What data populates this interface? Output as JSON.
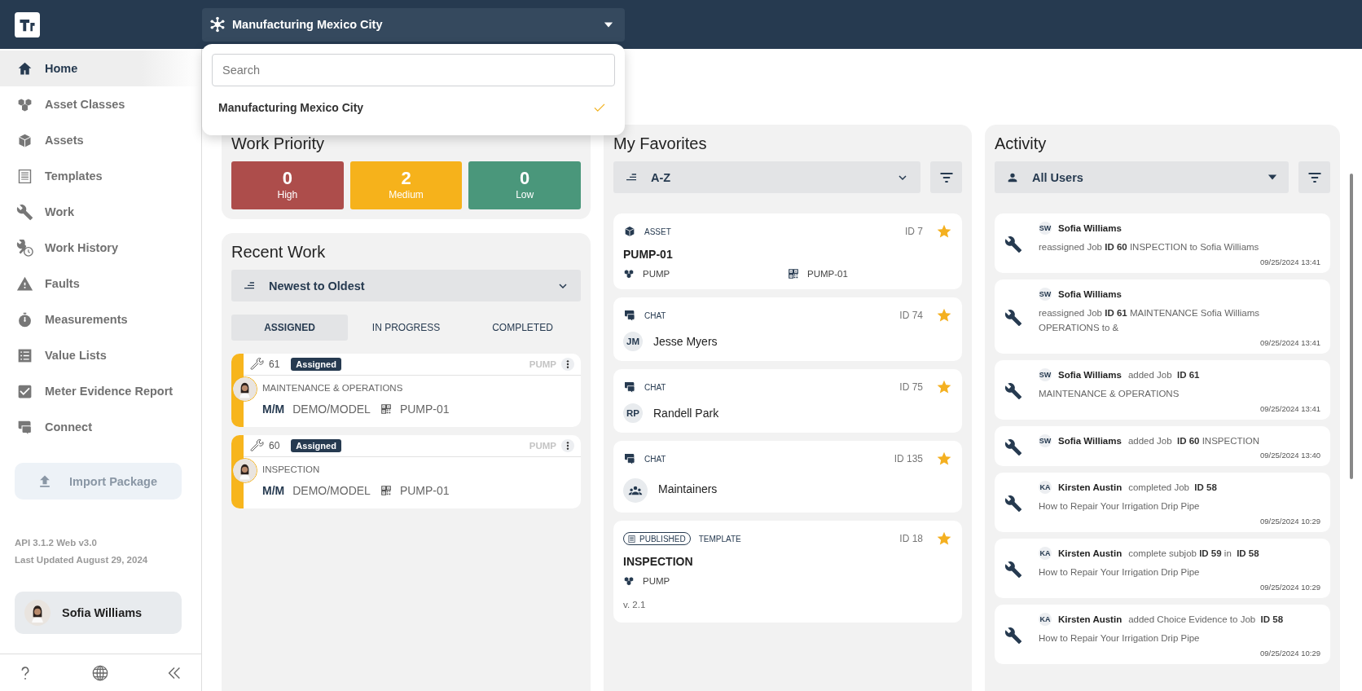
{
  "header": {
    "site": "Manufacturing Mexico City"
  },
  "site_menu": {
    "search": {
      "placeholder": "Search"
    },
    "options": [
      {
        "label": "Manufacturing Mexico City",
        "selected": true
      }
    ]
  },
  "sidebar": {
    "items": [
      {
        "label": "Home",
        "selected": true
      },
      {
        "label": "Asset Classes",
        "selected": false
      },
      {
        "label": "Assets",
        "selected": false
      },
      {
        "label": "Templates",
        "selected": false
      },
      {
        "label": "Work",
        "selected": false
      },
      {
        "label": "Work History",
        "selected": false
      },
      {
        "label": "Faults",
        "selected": false
      },
      {
        "label": "Measurements",
        "selected": false
      },
      {
        "label": "Value Lists",
        "selected": false
      },
      {
        "label": "Meter Evidence Report",
        "selected": false
      },
      {
        "label": "Connect",
        "selected": false
      }
    ],
    "import_button": "Import Package",
    "version": "API 3.1.2 Web v3.0",
    "updated": "Last Updated August 29, 2024",
    "user": "Sofia Williams"
  },
  "work_priority": {
    "title": "Work Priority",
    "tiles": [
      {
        "count": "0",
        "label": "High",
        "color": "#ad4d4b"
      },
      {
        "count": "2",
        "label": "Medium",
        "color": "#f6b21b"
      },
      {
        "count": "0",
        "label": "Low",
        "color": "#4a977b"
      }
    ]
  },
  "recent_work": {
    "title": "Recent Work",
    "sort": "Newest to Oldest",
    "tabs": [
      {
        "label": "ASSIGNED",
        "selected": true
      },
      {
        "label": "IN PROGRESS",
        "selected": false
      },
      {
        "label": "COMPLETED",
        "selected": false
      }
    ],
    "jobs": [
      {
        "id": "61",
        "status": "Assigned",
        "asset_class": "PUMP",
        "title": "MAINTENANCE & OPERATIONS",
        "make": "M/M",
        "model": "DEMO/MODEL",
        "asset": "PUMP-01",
        "color": "#f7b51d"
      },
      {
        "id": "60",
        "status": "Assigned",
        "asset_class": "PUMP",
        "title": "INSPECTION",
        "make": "M/M",
        "model": "DEMO/MODEL",
        "asset": "PUMP-01",
        "color": "#f7b51d"
      }
    ]
  },
  "favorites": {
    "title": "My Favorites",
    "sort": "A-Z",
    "items": [
      {
        "kind": "asset",
        "type": "ASSET",
        "id": "ID 7",
        "starred": true,
        "name": "PUMP-01",
        "asset_class": "PUMP",
        "asset": "PUMP-01"
      },
      {
        "kind": "chat",
        "type": "CHAT",
        "id": "ID 74",
        "starred": true,
        "initials": "JM",
        "name": "Jesse Myers"
      },
      {
        "kind": "chat",
        "type": "CHAT",
        "id": "ID 75",
        "starred": true,
        "initials": "RP",
        "name": "Randell Park"
      },
      {
        "kind": "chat",
        "type": "CHAT",
        "id": "ID 135",
        "starred": true,
        "name": "Maintainers"
      },
      {
        "kind": "template",
        "badge": "PUBLISHED",
        "type": "TEMPLATE",
        "id": "ID 18",
        "starred": true,
        "name": "INSPECTION",
        "asset_class": "PUMP",
        "version": "v. 2.1"
      }
    ]
  },
  "activity": {
    "title": "Activity",
    "filter": "All Users",
    "items": [
      {
        "initials": "SW",
        "user": "Sofia Williams",
        "detail": "reassigned Job **ID 60** INSPECTION to Sofia Williams",
        "time": "09/25/2024 13:41"
      },
      {
        "initials": "SW",
        "user": "Sofia Williams",
        "detail": "reassigned Job **ID 61** MAINTENANCE Sofia Williams OPERATIONS to &",
        "time": "09/25/2024 13:41"
      },
      {
        "initials": "SW",
        "user": "Sofia Williams",
        "action": "added Job  **ID 61**",
        "detail": "MAINTENANCE & OPERATIONS",
        "time": "09/25/2024 13:41"
      },
      {
        "initials": "SW",
        "user": "Sofia Williams",
        "action": "added Job  **ID 60** INSPECTION",
        "time": "09/25/2024 13:40"
      },
      {
        "initials": "KA",
        "user": "Kirsten Austin",
        "action": "completed Job  **ID 58**",
        "detail": "How to Repair Your Irrigation Drip Pipe",
        "time": "09/25/2024 10:29"
      },
      {
        "initials": "KA",
        "user": "Kirsten Austin",
        "action": "complete subjob **ID 59** in  **ID 58**",
        "detail": "How to Repair Your Irrigation Drip Pipe",
        "time": "09/25/2024 10:29"
      },
      {
        "initials": "KA",
        "user": "Kirsten Austin",
        "action": "added Choice Evidence to Job  **ID 58**",
        "detail": "How to Repair Your Irrigation Drip Pipe",
        "time": "09/25/2024 10:29"
      }
    ]
  }
}
